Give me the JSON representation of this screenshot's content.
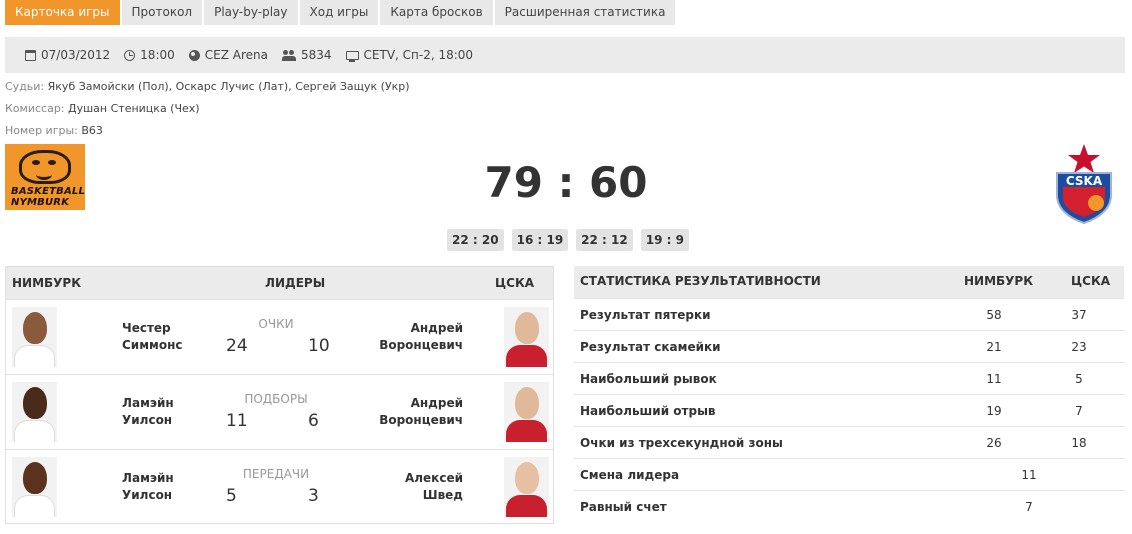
{
  "tabs": [
    "Карточка игры",
    "Протокол",
    "Play-by-play",
    "Ход игры",
    "Карта бросков",
    "Расширенная статистика"
  ],
  "info": {
    "date": "07/03/2012",
    "time": "18:00",
    "arena": "CEZ Arena",
    "attendance": "5834",
    "tv": "CETV, Сп-2, 18:00"
  },
  "officials": {
    "referees_label": "Судьи:",
    "referees": "Якуб Замойски (Пол), Оскарс Лучис (Лат), Сергей Защук (Укр)",
    "commissioner_label": "Комиссар:",
    "commissioner": "Душан Стеницка (Чех)",
    "game_no_label": "Номер игры:",
    "game_no": "B63"
  },
  "home_logo": {
    "line1": "BASKETBALL",
    "line2": "NYMBURK"
  },
  "away_logo": {
    "text": "CSKA"
  },
  "score": "79 : 60",
  "quarters": [
    "22 : 20",
    "16 : 19",
    "22 : 12",
    "19 : 9"
  ],
  "leaders": {
    "home_header": "НИМБУРК",
    "mid_header": "ЛИДЕРЫ",
    "away_header": "ЦСКА",
    "rows": [
      {
        "category": "ОЧКИ",
        "home_first": "Честер",
        "home_last": "Симмонс",
        "home_value": "24",
        "away_value": "10",
        "away_first": "Андрей",
        "away_last": "Воронцевич"
      },
      {
        "category": "ПОДБОРЫ",
        "home_first": "Ламэйн",
        "home_last": "Уилсон",
        "home_value": "11",
        "away_value": "6",
        "away_first": "Андрей",
        "away_last": "Воронцевич"
      },
      {
        "category": "ПЕРЕДАЧИ",
        "home_first": "Ламэйн",
        "home_last": "Уилсон",
        "home_value": "5",
        "away_value": "3",
        "away_first": "Алексей",
        "away_last": "Швед"
      }
    ]
  },
  "stats": {
    "header": "СТАТИСТИКА РЕЗУЛЬТАТИВНОСТИ",
    "home_header": "НИМБУРК",
    "away_header": "ЦСКА",
    "rows": [
      {
        "label": "Результат пятерки",
        "home": "58",
        "away": "37"
      },
      {
        "label": "Результат скамейки",
        "home": "21",
        "away": "23"
      },
      {
        "label": "Наибольший рывок",
        "home": "11",
        "away": "5"
      },
      {
        "label": "Наибольший отрыв",
        "home": "19",
        "away": "7"
      },
      {
        "label": "Очки из трехсекундной зоны",
        "home": "26",
        "away": "18"
      },
      {
        "label": "Смена лидера",
        "combined": "11"
      },
      {
        "label": "Равный счет",
        "combined": "7"
      }
    ]
  }
}
